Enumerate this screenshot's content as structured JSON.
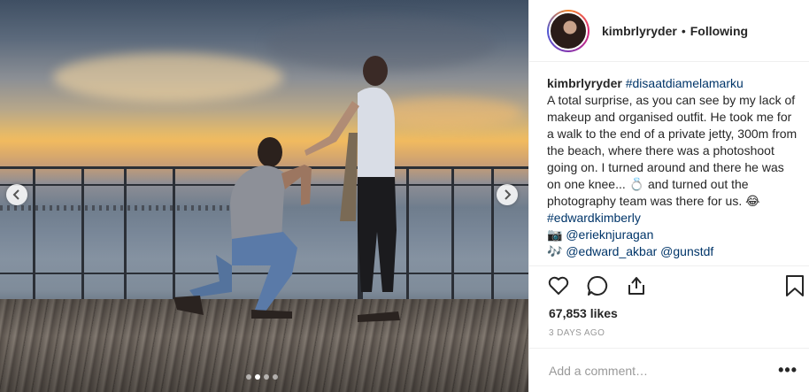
{
  "post": {
    "username": "kimbrlyryder",
    "separator": "•",
    "follow_status": "Following",
    "caption": {
      "username": "kimbrlyryder",
      "hashtag_primary": "#disaatdiamelamarku",
      "body": "A total surprise, as you can see by my lack of makeup and organised outfit. He took me for a walk to the end of a private jetty, 300m from the beach, where there was a photoshoot going on. I turned around and there he was on one knee... 💍 and turned out the photography team was there for us. 😂",
      "hashtag_secondary": "#edwardkimberly",
      "camera_emoji": "📷",
      "camera_credit": "@erieknjuragan",
      "music_emoji": "🎶",
      "music_credit_1": "@edward_akbar",
      "music_credit_2": "@gunstdf"
    },
    "likes": "67,853 likes",
    "date": "3 DAYS AGO",
    "comment_placeholder": "Add a comment…",
    "more_label": "•••"
  },
  "carousel": {
    "slides": 4,
    "active_index": 1
  },
  "icons": {
    "like": "heart-icon",
    "comment": "comment-icon",
    "share": "share-icon",
    "save": "bookmark-icon",
    "prev": "chevron-left-icon",
    "next": "chevron-right-icon"
  },
  "colors": {
    "link": "#003569",
    "text": "#262626",
    "muted": "#999999",
    "border": "#efefef"
  }
}
